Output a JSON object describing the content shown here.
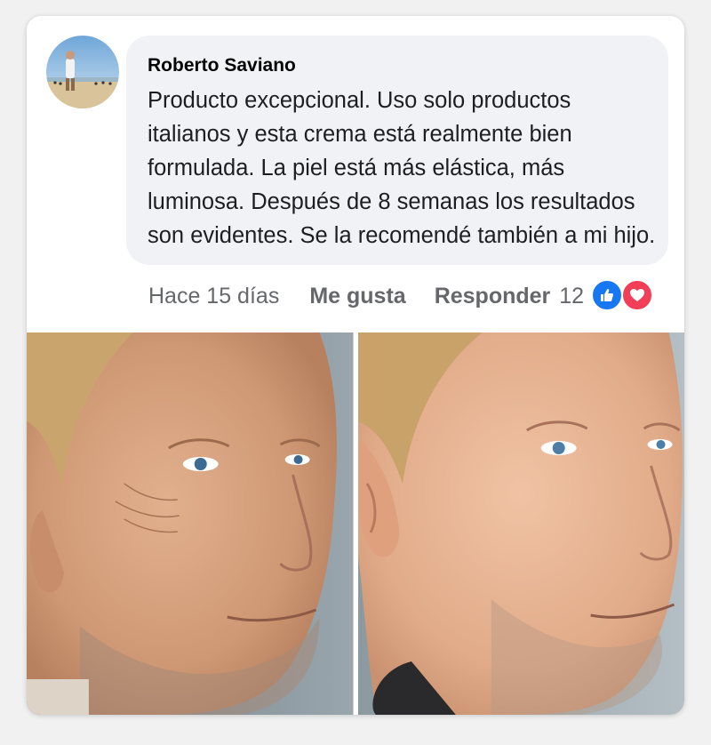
{
  "comment": {
    "author": "Roberto Saviano",
    "text": "Producto excepcional. Uso solo productos italianos y esta crema está realmente bien formulada. La piel está más elástica, más luminosa. Después de 8 semanas los resultados son evidentes. Se la recomendé también a mi hijo.",
    "time": "Hace 15 días",
    "like_label": "Me gusta",
    "reply_label": "Responder",
    "reaction_count": "12",
    "reactions": [
      "like-icon",
      "love-icon"
    ]
  },
  "colors": {
    "bubble": "#f0f2f5",
    "meta_text": "#65676b",
    "like_blue": "#1877f2",
    "love_red": "#f33e58"
  }
}
